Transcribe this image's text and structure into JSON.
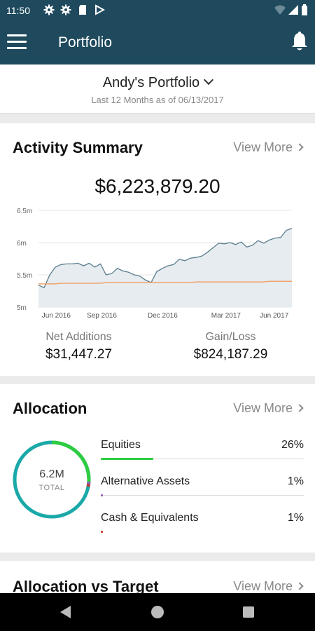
{
  "status_bar": {
    "time": "11:50",
    "icons": [
      "gear-icon",
      "gear-icon",
      "sd-card-icon",
      "play-store-icon",
      "wifi-icon",
      "signal-icon",
      "battery-icon"
    ]
  },
  "app_bar": {
    "title": "Portfolio",
    "menu_icon": "hamburger-menu-icon",
    "notification_icon": "bell-icon"
  },
  "portfolio": {
    "name": "Andy's Portfolio",
    "subtitle": "Last 12 Months as of 06/13/2017"
  },
  "activity_summary": {
    "title": "Activity Summary",
    "view_more": "View More",
    "total": "$6,223,879.20",
    "net_additions_label": "Net Additions",
    "net_additions_value": "$31,447.27",
    "gain_loss_label": "Gain/Loss",
    "gain_loss_value": "$824,187.29"
  },
  "chart_data": {
    "type": "area",
    "title": "",
    "xlabel": "",
    "ylabel": "",
    "y_ticks": [
      "6.5m",
      "6m",
      "5.5m",
      "5m"
    ],
    "y_tick_values": [
      6.5,
      6.0,
      5.5,
      5.0
    ],
    "ylim": [
      5.0,
      6.5
    ],
    "x_ticks": [
      "Jun 2016",
      "Sep 2016",
      "Dec 2016",
      "Mar 2017",
      "Jun 2017"
    ],
    "x_tick_positions": [
      0.07,
      0.25,
      0.49,
      0.74,
      0.93
    ],
    "grid": true,
    "series": [
      {
        "color": "#5a7d8e",
        "fill": "#e6ecef",
        "values": [
          5.34,
          5.3,
          5.5,
          5.62,
          5.66,
          5.67,
          5.67,
          5.68,
          5.64,
          5.68,
          5.62,
          5.67,
          5.5,
          5.52,
          5.6,
          5.56,
          5.54,
          5.5,
          5.48,
          5.42,
          5.38,
          5.55,
          5.6,
          5.64,
          5.66,
          5.74,
          5.72,
          5.76,
          5.77,
          5.79,
          5.85,
          5.92,
          5.99,
          5.98,
          6.0,
          5.97,
          6.01,
          5.93,
          5.96,
          6.03,
          5.99,
          6.04,
          6.07,
          6.08,
          6.19,
          6.22
        ]
      },
      {
        "color": "#f0a36e",
        "values": [
          5.36,
          5.36,
          5.36,
          5.36,
          5.37,
          5.37,
          5.37,
          5.37,
          5.37,
          5.37,
          5.37,
          5.37,
          5.38,
          5.38,
          5.38,
          5.38,
          5.38,
          5.38,
          5.38,
          5.38,
          5.38,
          5.38,
          5.38,
          5.38,
          5.38,
          5.38,
          5.38,
          5.38,
          5.39,
          5.39,
          5.39,
          5.39,
          5.39,
          5.39,
          5.39,
          5.39,
          5.39,
          5.39,
          5.39,
          5.39,
          5.39,
          5.4,
          5.4,
          5.4,
          5.4,
          5.4
        ]
      }
    ]
  },
  "allocation": {
    "title": "Allocation",
    "view_more": "View More",
    "total_value": "6.2M",
    "total_label": "TOTAL",
    "items": [
      {
        "name": "Equities",
        "percent": "26%",
        "fraction": 0.26,
        "color": "#2ecc40"
      },
      {
        "name": "Alternative Assets",
        "percent": "1%",
        "fraction": 0.01,
        "color": "#9b59b6"
      },
      {
        "name": "Cash & Equivalents",
        "percent": "1%",
        "fraction": 0.01,
        "color": "#c0392b"
      }
    ],
    "donut_base_color": "#1aa8a8"
  },
  "allocation_vs_target": {
    "title": "Allocation vs Target",
    "view_more": "View More"
  },
  "nav_bar": {
    "icons": [
      "back-icon",
      "home-icon",
      "recents-icon"
    ]
  }
}
